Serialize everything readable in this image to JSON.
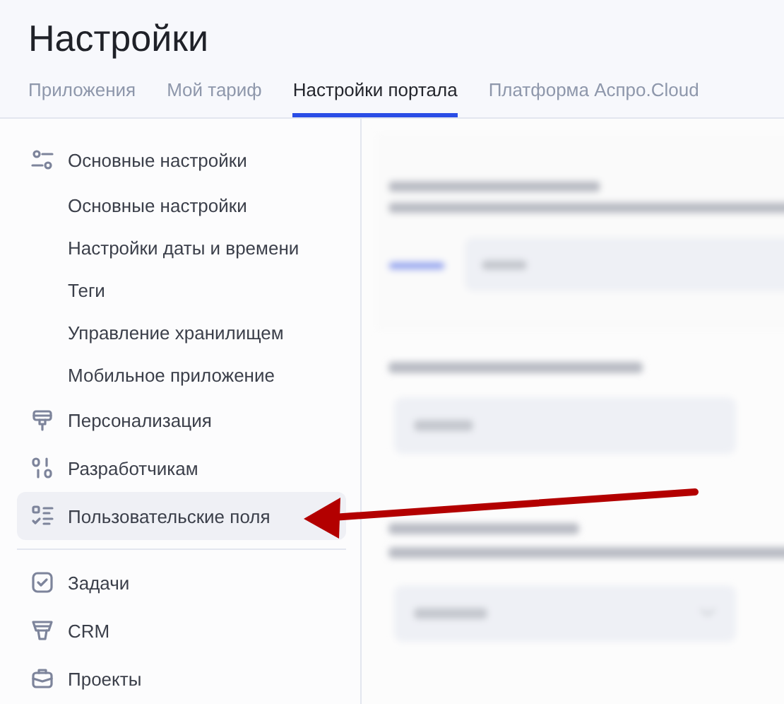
{
  "page": {
    "title": "Настройки"
  },
  "tabs": [
    {
      "label": "Приложения",
      "selected": false
    },
    {
      "label": "Мой тариф",
      "selected": false
    },
    {
      "label": "Настройки портала",
      "selected": true
    },
    {
      "label": "Платформа Аспро.Cloud",
      "selected": false
    }
  ],
  "sidebar": {
    "sections": [
      {
        "items": [
          {
            "label": "Основные настройки",
            "selected": false,
            "children": [
              {
                "label": "Основные настройки",
                "selected": false
              },
              {
                "label": "Настройки даты и времени",
                "selected": false
              },
              {
                "label": "Теги",
                "selected": false
              },
              {
                "label": "Управление хранилищем",
                "selected": false
              },
              {
                "label": "Мобильное приложение",
                "selected": false
              }
            ]
          },
          {
            "label": "Персонализация",
            "selected": false
          },
          {
            "label": "Разработчикам",
            "selected": false
          },
          {
            "label": "Пользовательские поля",
            "selected": true
          }
        ]
      },
      {
        "items": [
          {
            "label": "Задачи",
            "selected": false
          },
          {
            "label": "CRM",
            "selected": false
          },
          {
            "label": "Проекты",
            "selected": false
          }
        ]
      }
    ]
  }
}
